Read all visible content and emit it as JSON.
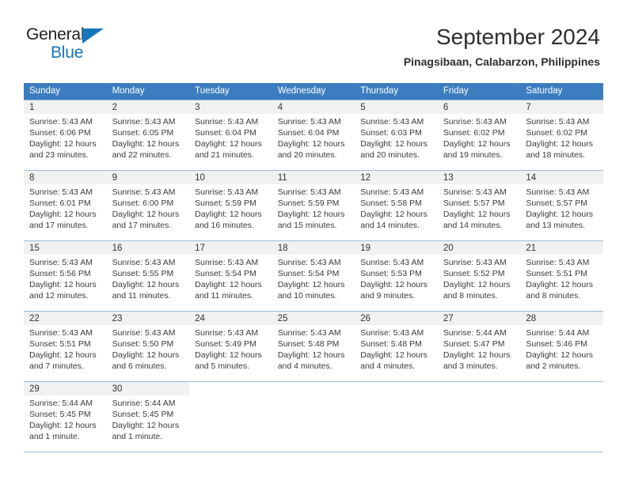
{
  "brand": {
    "line1": "General",
    "line2": "Blue",
    "triangle_color": "#1576bc",
    "text_color": "#231f20"
  },
  "header": {
    "title": "September 2024",
    "subtitle": "Pinagsibaan, Calabarzon, Philippines"
  },
  "theme": {
    "header_blue": "#3c7dc0",
    "row_line": "#9bb9d9",
    "day_band": "#f1f1f1"
  },
  "weekdays": [
    "Sunday",
    "Monday",
    "Tuesday",
    "Wednesday",
    "Thursday",
    "Friday",
    "Saturday"
  ],
  "labels": {
    "sunrise_prefix": "Sunrise:",
    "sunset_prefix": "Sunset:",
    "daylight_prefix": "Daylight:"
  },
  "weeks": [
    [
      {
        "day": "1",
        "sunrise": "Sunrise: 5:43 AM",
        "sunset": "Sunset: 6:06 PM",
        "daylight_line1": "Daylight: 12 hours",
        "daylight_line2": "and 23 minutes."
      },
      {
        "day": "2",
        "sunrise": "Sunrise: 5:43 AM",
        "sunset": "Sunset: 6:05 PM",
        "daylight_line1": "Daylight: 12 hours",
        "daylight_line2": "and 22 minutes."
      },
      {
        "day": "3",
        "sunrise": "Sunrise: 5:43 AM",
        "sunset": "Sunset: 6:04 PM",
        "daylight_line1": "Daylight: 12 hours",
        "daylight_line2": "and 21 minutes."
      },
      {
        "day": "4",
        "sunrise": "Sunrise: 5:43 AM",
        "sunset": "Sunset: 6:04 PM",
        "daylight_line1": "Daylight: 12 hours",
        "daylight_line2": "and 20 minutes."
      },
      {
        "day": "5",
        "sunrise": "Sunrise: 5:43 AM",
        "sunset": "Sunset: 6:03 PM",
        "daylight_line1": "Daylight: 12 hours",
        "daylight_line2": "and 20 minutes."
      },
      {
        "day": "6",
        "sunrise": "Sunrise: 5:43 AM",
        "sunset": "Sunset: 6:02 PM",
        "daylight_line1": "Daylight: 12 hours",
        "daylight_line2": "and 19 minutes."
      },
      {
        "day": "7",
        "sunrise": "Sunrise: 5:43 AM",
        "sunset": "Sunset: 6:02 PM",
        "daylight_line1": "Daylight: 12 hours",
        "daylight_line2": "and 18 minutes."
      }
    ],
    [
      {
        "day": "8",
        "sunrise": "Sunrise: 5:43 AM",
        "sunset": "Sunset: 6:01 PM",
        "daylight_line1": "Daylight: 12 hours",
        "daylight_line2": "and 17 minutes."
      },
      {
        "day": "9",
        "sunrise": "Sunrise: 5:43 AM",
        "sunset": "Sunset: 6:00 PM",
        "daylight_line1": "Daylight: 12 hours",
        "daylight_line2": "and 17 minutes."
      },
      {
        "day": "10",
        "sunrise": "Sunrise: 5:43 AM",
        "sunset": "Sunset: 5:59 PM",
        "daylight_line1": "Daylight: 12 hours",
        "daylight_line2": "and 16 minutes."
      },
      {
        "day": "11",
        "sunrise": "Sunrise: 5:43 AM",
        "sunset": "Sunset: 5:59 PM",
        "daylight_line1": "Daylight: 12 hours",
        "daylight_line2": "and 15 minutes."
      },
      {
        "day": "12",
        "sunrise": "Sunrise: 5:43 AM",
        "sunset": "Sunset: 5:58 PM",
        "daylight_line1": "Daylight: 12 hours",
        "daylight_line2": "and 14 minutes."
      },
      {
        "day": "13",
        "sunrise": "Sunrise: 5:43 AM",
        "sunset": "Sunset: 5:57 PM",
        "daylight_line1": "Daylight: 12 hours",
        "daylight_line2": "and 14 minutes."
      },
      {
        "day": "14",
        "sunrise": "Sunrise: 5:43 AM",
        "sunset": "Sunset: 5:57 PM",
        "daylight_line1": "Daylight: 12 hours",
        "daylight_line2": "and 13 minutes."
      }
    ],
    [
      {
        "day": "15",
        "sunrise": "Sunrise: 5:43 AM",
        "sunset": "Sunset: 5:56 PM",
        "daylight_line1": "Daylight: 12 hours",
        "daylight_line2": "and 12 minutes."
      },
      {
        "day": "16",
        "sunrise": "Sunrise: 5:43 AM",
        "sunset": "Sunset: 5:55 PM",
        "daylight_line1": "Daylight: 12 hours",
        "daylight_line2": "and 11 minutes."
      },
      {
        "day": "17",
        "sunrise": "Sunrise: 5:43 AM",
        "sunset": "Sunset: 5:54 PM",
        "daylight_line1": "Daylight: 12 hours",
        "daylight_line2": "and 11 minutes."
      },
      {
        "day": "18",
        "sunrise": "Sunrise: 5:43 AM",
        "sunset": "Sunset: 5:54 PM",
        "daylight_line1": "Daylight: 12 hours",
        "daylight_line2": "and 10 minutes."
      },
      {
        "day": "19",
        "sunrise": "Sunrise: 5:43 AM",
        "sunset": "Sunset: 5:53 PM",
        "daylight_line1": "Daylight: 12 hours",
        "daylight_line2": "and 9 minutes."
      },
      {
        "day": "20",
        "sunrise": "Sunrise: 5:43 AM",
        "sunset": "Sunset: 5:52 PM",
        "daylight_line1": "Daylight: 12 hours",
        "daylight_line2": "and 8 minutes."
      },
      {
        "day": "21",
        "sunrise": "Sunrise: 5:43 AM",
        "sunset": "Sunset: 5:51 PM",
        "daylight_line1": "Daylight: 12 hours",
        "daylight_line2": "and 8 minutes."
      }
    ],
    [
      {
        "day": "22",
        "sunrise": "Sunrise: 5:43 AM",
        "sunset": "Sunset: 5:51 PM",
        "daylight_line1": "Daylight: 12 hours",
        "daylight_line2": "and 7 minutes."
      },
      {
        "day": "23",
        "sunrise": "Sunrise: 5:43 AM",
        "sunset": "Sunset: 5:50 PM",
        "daylight_line1": "Daylight: 12 hours",
        "daylight_line2": "and 6 minutes."
      },
      {
        "day": "24",
        "sunrise": "Sunrise: 5:43 AM",
        "sunset": "Sunset: 5:49 PM",
        "daylight_line1": "Daylight: 12 hours",
        "daylight_line2": "and 5 minutes."
      },
      {
        "day": "25",
        "sunrise": "Sunrise: 5:43 AM",
        "sunset": "Sunset: 5:48 PM",
        "daylight_line1": "Daylight: 12 hours",
        "daylight_line2": "and 4 minutes."
      },
      {
        "day": "26",
        "sunrise": "Sunrise: 5:43 AM",
        "sunset": "Sunset: 5:48 PM",
        "daylight_line1": "Daylight: 12 hours",
        "daylight_line2": "and 4 minutes."
      },
      {
        "day": "27",
        "sunrise": "Sunrise: 5:44 AM",
        "sunset": "Sunset: 5:47 PM",
        "daylight_line1": "Daylight: 12 hours",
        "daylight_line2": "and 3 minutes."
      },
      {
        "day": "28",
        "sunrise": "Sunrise: 5:44 AM",
        "sunset": "Sunset: 5:46 PM",
        "daylight_line1": "Daylight: 12 hours",
        "daylight_line2": "and 2 minutes."
      }
    ],
    [
      {
        "day": "29",
        "sunrise": "Sunrise: 5:44 AM",
        "sunset": "Sunset: 5:45 PM",
        "daylight_line1": "Daylight: 12 hours",
        "daylight_line2": "and 1 minute."
      },
      {
        "day": "30",
        "sunrise": "Sunrise: 5:44 AM",
        "sunset": "Sunset: 5:45 PM",
        "daylight_line1": "Daylight: 12 hours",
        "daylight_line2": "and 1 minute."
      },
      null,
      null,
      null,
      null,
      null
    ]
  ]
}
